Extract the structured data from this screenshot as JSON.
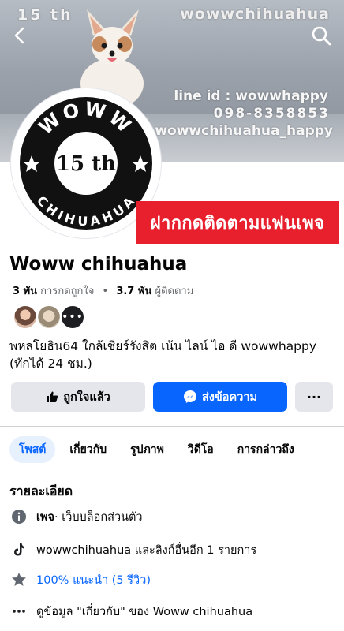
{
  "cover": {
    "top_left_text": "15 th",
    "top_right_text": "wowwchihuahua",
    "line_text": "line id : wowwhappy",
    "phone_text": "098-8358853",
    "tiktok_text": ": wowwchihuahua_happy"
  },
  "nav": {
    "back_icon": "chevron-left-icon",
    "search_icon": "search-icon"
  },
  "logo": {
    "top_word": "WOWW",
    "center_text": "15 th",
    "bottom_word": "CHIHUAHUA"
  },
  "banner": {
    "text": "ฝากกดติดตามแฟนเพจ"
  },
  "page": {
    "name": "Woww chihuahua",
    "likes_value": "3 พัน",
    "likes_label": "การกดถูกใจ",
    "followers_value": "3.7 พัน",
    "followers_label": "ผู้ติดตาม",
    "mutual_more": "•••",
    "bio": "พหลโยธิน64 ใกล้เชียร์รังสิต เน้น ไลน์ ไอ ดี wowwhappy (ทักได้ 24 ชม.)"
  },
  "actions": {
    "like_label": "ถูกใจแล้ว",
    "message_label": "ส่งข้อความ",
    "more_label": "···"
  },
  "tabs": [
    {
      "label": "โพสต์",
      "active": true
    },
    {
      "label": "เกี่ยวกับ",
      "active": false
    },
    {
      "label": "รูปภาพ",
      "active": false
    },
    {
      "label": "วิดีโอ",
      "active": false
    },
    {
      "label": "การกล่าวถึง",
      "active": false
    }
  ],
  "details": {
    "title": "รายละเอียด",
    "page_type_bold": "เพจ",
    "page_type_rest": " · เว็บบล็อกส่วนตัว",
    "tiktok_row": "wowwchihuahua และลิงก์อื่นอีก 1 รายการ",
    "rating_row": "100% แนะนำ (5 รีวิว)",
    "about_row": "ดูข้อมูล \"เกี่ยวกับ\" ของ Woww chihuahua"
  },
  "colors": {
    "accent": "#0866ff",
    "banner": "#e8202d",
    "button_gray": "#e4e6eb"
  }
}
